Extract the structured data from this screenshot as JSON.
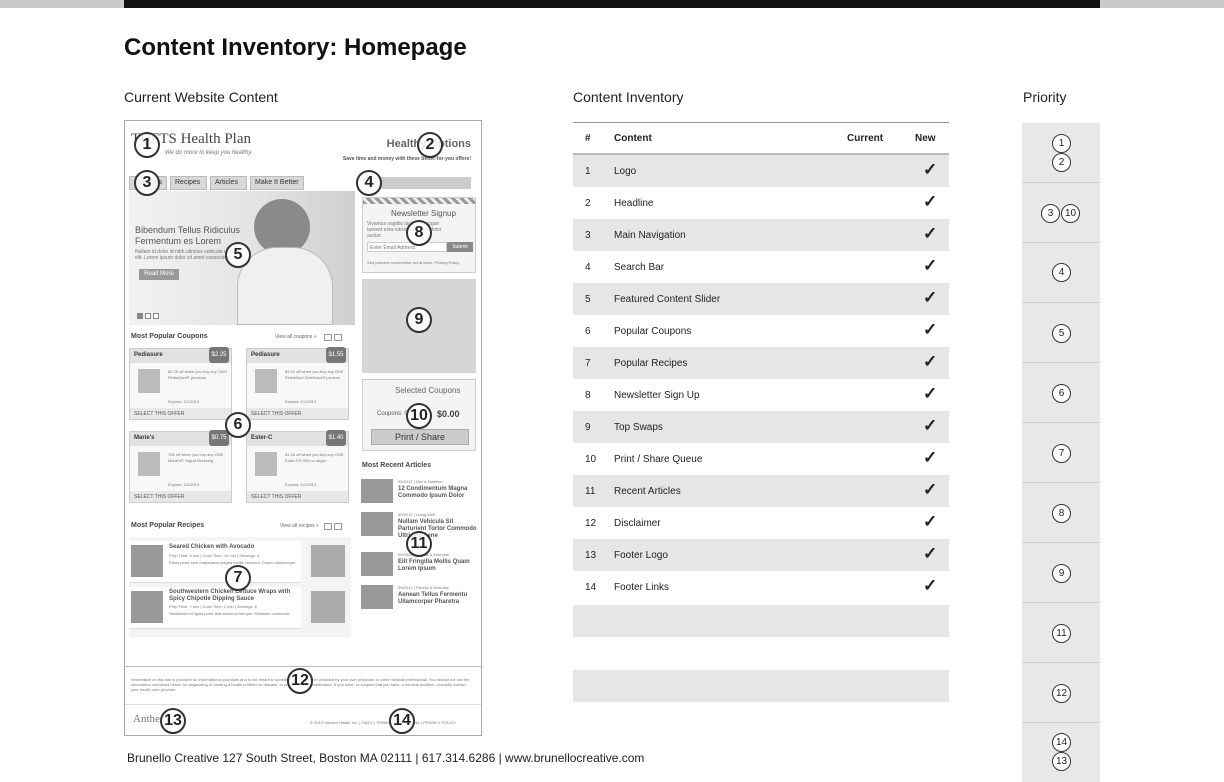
{
  "page_title": "Content Inventory: Homepage",
  "columns": {
    "current": "Current Website Content",
    "inventory": "Content Inventory",
    "priority": "Priority"
  },
  "mock_site": {
    "logo_text": "TUFTS Health Plan",
    "tagline": "We do more to keep you healthy.",
    "header_title": "Healthy Options",
    "header_sub": "Save time and money with these better-for-you offers!",
    "nav_tabs": [
      "Coupons",
      "Recipes",
      "Articles",
      "Make It Better"
    ],
    "hero_title_1": "Bibendum Tellus Ridiculus",
    "hero_title_2": "Fermentum es Lorem",
    "hero_body": "Nullam id dolor id nibh ultricies vehicula ut id elit. Lorem ipsum dolor sit amet consectetur.",
    "hero_button": "Read More",
    "newsletter_title": "Newsletter Signup",
    "newsletter_body": "Vivamus sagittis lacus vel augue laoreet esta rutrum faucibus dolor auctor.",
    "newsletter_placeholder": "Enter Email Address",
    "newsletter_submit": "Submit",
    "newsletter_consent": "Sed posuere consectetur est at lobor. Privacy Policy",
    "coupons_heading": "Most Popular Coupons",
    "coupons_view_all": "View all coupons »",
    "coupons": [
      {
        "name": "Pediasure",
        "price": "$2.25",
        "desc": "$2.25 off when you buy any TWO PediaSure® products",
        "expires": "Expires: 1/1/2013",
        "select": "SELECT THIS OFFER"
      },
      {
        "name": "Pediasure",
        "price": "$1.55",
        "desc": "$1.00 off when you buy any ONE PediaSure SideKicks® product",
        "expires": "Expires: 1/1/2013",
        "select": "SELECT THIS OFFER"
      },
      {
        "name": "Marie's",
        "price": "$0.75",
        "desc": "75¢ off when you buy any ONE Marie's® Yogurt Dressing",
        "expires": "Expires: 1/1/2013",
        "select": "SELECT THIS OFFER"
      },
      {
        "name": "Ester-C",
        "price": "$1.40",
        "desc": "$1.40 off when you buy any ONE Ester-C® 90ct or larger",
        "expires": "Expires: 1/1/2013",
        "select": "SELECT THIS OFFER"
      }
    ],
    "selected_coupons_title": "Selected Coupons",
    "coupons_label": "Coupons: 0",
    "coupons_total": "$0.00",
    "print_share": "Print / Share",
    "recent_articles_heading": "Most Recent Articles",
    "articles": [
      {
        "meta": "09/2012 | Diet & Nutrition",
        "title": "12 Condimentum Magna Commodo Ipsum Dolor"
      },
      {
        "meta": "09/2012 | Living Well",
        "title": "Nullam Vehicula Sit Parturient Tortor Commodo Ultricies Aene"
      },
      {
        "meta": "09/2012 | Fitness & Exercise",
        "title": "Elit Fringilla Mollis Quam Lorem Ipsum"
      },
      {
        "meta": "09/2012 | Fitness & Exercise",
        "title": "Aenean Tellus Fermentu Ullamcorper Pharetra"
      }
    ],
    "recipes_heading": "Most Popular Recipes",
    "recipes_view_all": "View all recipes »",
    "recipes": [
      {
        "title": "Seared Chicken with Avocado",
        "meta": "Prep Time: 5 min | Cook Time: 10 min | Servings: 4",
        "desc": "Etiam porta sem malesuada magna mollis euismod. Donec ullamcorper."
      },
      {
        "title": "Southwestern Chicken Lettuce Wraps with Spicy Chipotle Dipping Sauce",
        "meta": "Prep Time: 7 min | Cook Time: 2 min | Servings: 6",
        "desc": "Vestibulum id ligula porta felis euismod semper. Praesent commodo."
      }
    ],
    "disclaimer": "Information on this site is provided for informational purposes and is not meant to substitute for the advice provided by your own physician or other medical professional. You should not use the information contained herein for diagnosing or treating a health problem or disease, or prescribing any medication. If you have, or suspect that you have, a medical problem, promptly contact your health care provider.",
    "footer_logo": "Anthem",
    "footer_links": "© 2012 Unicorn Health Inc.  |  FAQ'S  |  TERMS & CONDITIONS  |  PRIVACY POLICY"
  },
  "badges": [
    "1",
    "2",
    "3",
    "4",
    "5",
    "6",
    "7",
    "8",
    "9",
    "10",
    "11",
    "12",
    "13",
    "14"
  ],
  "inventory": {
    "headers": {
      "num": "#",
      "content": "Content",
      "current": "Current",
      "new": "New"
    },
    "check": "✓",
    "rows": [
      {
        "num": "1",
        "content": "Logo",
        "new": true
      },
      {
        "num": "2",
        "content": "Headline",
        "new": true
      },
      {
        "num": "3",
        "content": "Main Navigation",
        "new": true
      },
      {
        "num": "4",
        "content": "Search Bar",
        "new": true
      },
      {
        "num": "5",
        "content": "Featured Content Slider",
        "new": true
      },
      {
        "num": "6",
        "content": "Popular Coupons",
        "new": true
      },
      {
        "num": "7",
        "content": "Popular Recipes",
        "new": true
      },
      {
        "num": "8",
        "content": "Newsletter Sign Up",
        "new": true
      },
      {
        "num": "9",
        "content": "Top Swaps",
        "new": true
      },
      {
        "num": "10",
        "content": "Print / Share Queue",
        "new": true
      },
      {
        "num": "11",
        "content": "Recent Articles",
        "new": true
      },
      {
        "num": "12",
        "content": "Disclaimer",
        "new": true
      },
      {
        "num": "13",
        "content": "Footer Logo",
        "new": true
      },
      {
        "num": "14",
        "content": "Footer Links",
        "new": true
      }
    ]
  },
  "priority": [
    [
      "1",
      "2"
    ],
    [
      "3",
      "10"
    ],
    [
      "4"
    ],
    [
      "5"
    ],
    [
      "6"
    ],
    [
      "7"
    ],
    [
      "8"
    ],
    [
      "9"
    ],
    [
      "11"
    ],
    [
      "12"
    ],
    [
      "14",
      "13"
    ]
  ],
  "footer": "Brunello Creative 127 South Street, Boston MA 02111 | 617.314.6286 | www.brunellocreative.com",
  "colors": {
    "shade": "#e6e6e6",
    "topbar": "#111111",
    "priority_bg": "#e8e8e8"
  }
}
